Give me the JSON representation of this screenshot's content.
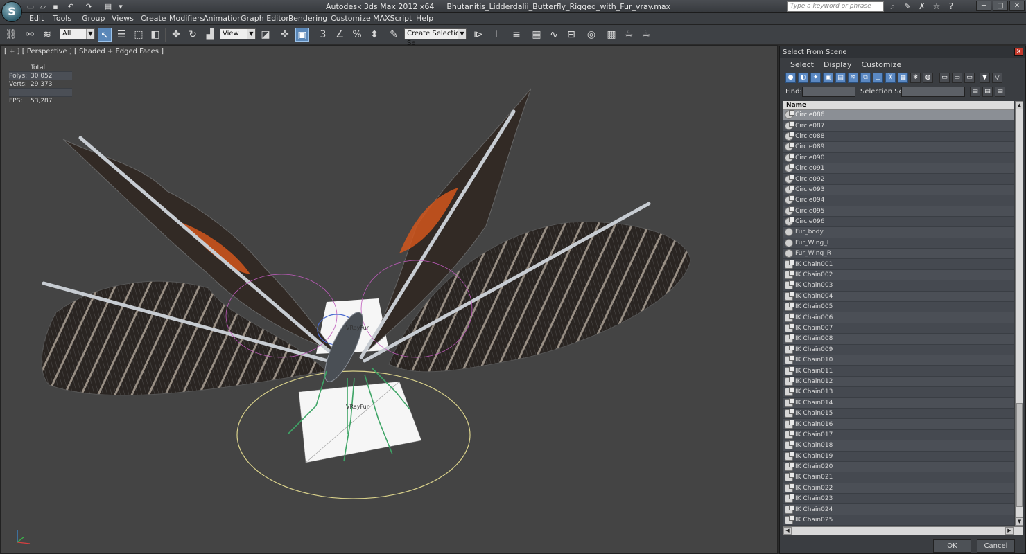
{
  "title": {
    "app": "Autodesk 3ds Max  2012 x64",
    "file": "Bhutanitis_Lidderdalii_Butterfly_Rigged_with_Fur_vray.max"
  },
  "search": {
    "placeholder": "Type a keyword or phrase"
  },
  "menu": [
    "Edit",
    "Tools",
    "Group",
    "Views",
    "Create",
    "Modifiers",
    "Animation",
    "Graph Editors",
    "Rendering",
    "Customize",
    "MAXScript",
    "Help"
  ],
  "toolbar": {
    "filter_value": "All",
    "refcoord_value": "View",
    "snap_label": "3",
    "selection_set_value": "Create Selection Se"
  },
  "viewport": {
    "label": "[ + ] [ Perspective ] [ Shaded + Edged Faces ]",
    "stats": {
      "total_label": "Total",
      "polys_label": "Polys:",
      "polys_value": "30 052",
      "verts_label": "Verts:",
      "verts_value": "29 373",
      "fps_label": "FPS:",
      "fps_value": "53,287"
    },
    "vrayfur_label": "VRayFur"
  },
  "panel": {
    "title": "Select From Scene",
    "menu": [
      "Select",
      "Display",
      "Customize"
    ],
    "find_label": "Find:",
    "selection_set_label": "Selection Set:",
    "column_name": "Name",
    "items": [
      {
        "name": "Circle086",
        "icon": "multi-circle-icon",
        "selected": true
      },
      {
        "name": "Circle087",
        "icon": "multi-circle-icon"
      },
      {
        "name": "Circle088",
        "icon": "multi-circle-icon"
      },
      {
        "name": "Circle089",
        "icon": "multi-circle-icon"
      },
      {
        "name": "Circle090",
        "icon": "multi-circle-icon"
      },
      {
        "name": "Circle091",
        "icon": "multi-circle-icon"
      },
      {
        "name": "Circle092",
        "icon": "multi-circle-icon"
      },
      {
        "name": "Circle093",
        "icon": "multi-circle-icon"
      },
      {
        "name": "Circle094",
        "icon": "multi-circle-icon"
      },
      {
        "name": "Circle095",
        "icon": "multi-circle-icon"
      },
      {
        "name": "Circle096",
        "icon": "multi-circle-icon"
      },
      {
        "name": "Fur_body",
        "icon": "sphere-icon"
      },
      {
        "name": "Fur_Wing_L",
        "icon": "sphere-icon"
      },
      {
        "name": "Fur_Wing_R",
        "icon": "sphere-icon"
      },
      {
        "name": "IK Chain001",
        "icon": "ik-chain-icon"
      },
      {
        "name": "IK Chain002",
        "icon": "ik-chain-icon"
      },
      {
        "name": "IK Chain003",
        "icon": "ik-chain-icon"
      },
      {
        "name": "IK Chain004",
        "icon": "ik-chain-icon"
      },
      {
        "name": "IK Chain005",
        "icon": "ik-chain-icon"
      },
      {
        "name": "IK Chain006",
        "icon": "ik-chain-icon"
      },
      {
        "name": "IK Chain007",
        "icon": "ik-chain-icon"
      },
      {
        "name": "IK Chain008",
        "icon": "ik-chain-icon"
      },
      {
        "name": "IK Chain009",
        "icon": "ik-chain-icon"
      },
      {
        "name": "IK Chain010",
        "icon": "ik-chain-icon"
      },
      {
        "name": "IK Chain011",
        "icon": "ik-chain-icon"
      },
      {
        "name": "IK Chain012",
        "icon": "ik-chain-icon"
      },
      {
        "name": "IK Chain013",
        "icon": "ik-chain-icon"
      },
      {
        "name": "IK Chain014",
        "icon": "ik-chain-icon"
      },
      {
        "name": "IK Chain015",
        "icon": "ik-chain-icon"
      },
      {
        "name": "IK Chain016",
        "icon": "ik-chain-icon"
      },
      {
        "name": "IK Chain017",
        "icon": "ik-chain-icon"
      },
      {
        "name": "IK Chain018",
        "icon": "ik-chain-icon"
      },
      {
        "name": "IK Chain019",
        "icon": "ik-chain-icon"
      },
      {
        "name": "IK Chain020",
        "icon": "ik-chain-icon"
      },
      {
        "name": "IK Chain021",
        "icon": "ik-chain-icon"
      },
      {
        "name": "IK Chain022",
        "icon": "ik-chain-icon"
      },
      {
        "name": "IK Chain023",
        "icon": "ik-chain-icon"
      },
      {
        "name": "IK Chain024",
        "icon": "ik-chain-icon"
      },
      {
        "name": "IK Chain025",
        "icon": "ik-chain-icon"
      }
    ],
    "ok_label": "OK",
    "cancel_label": "Cancel"
  },
  "colors": {
    "accent": "#5a87b8",
    "stats_text": "#e6cc3a",
    "viewport_bg": "#444444",
    "wing_orange": "#d2561c"
  }
}
